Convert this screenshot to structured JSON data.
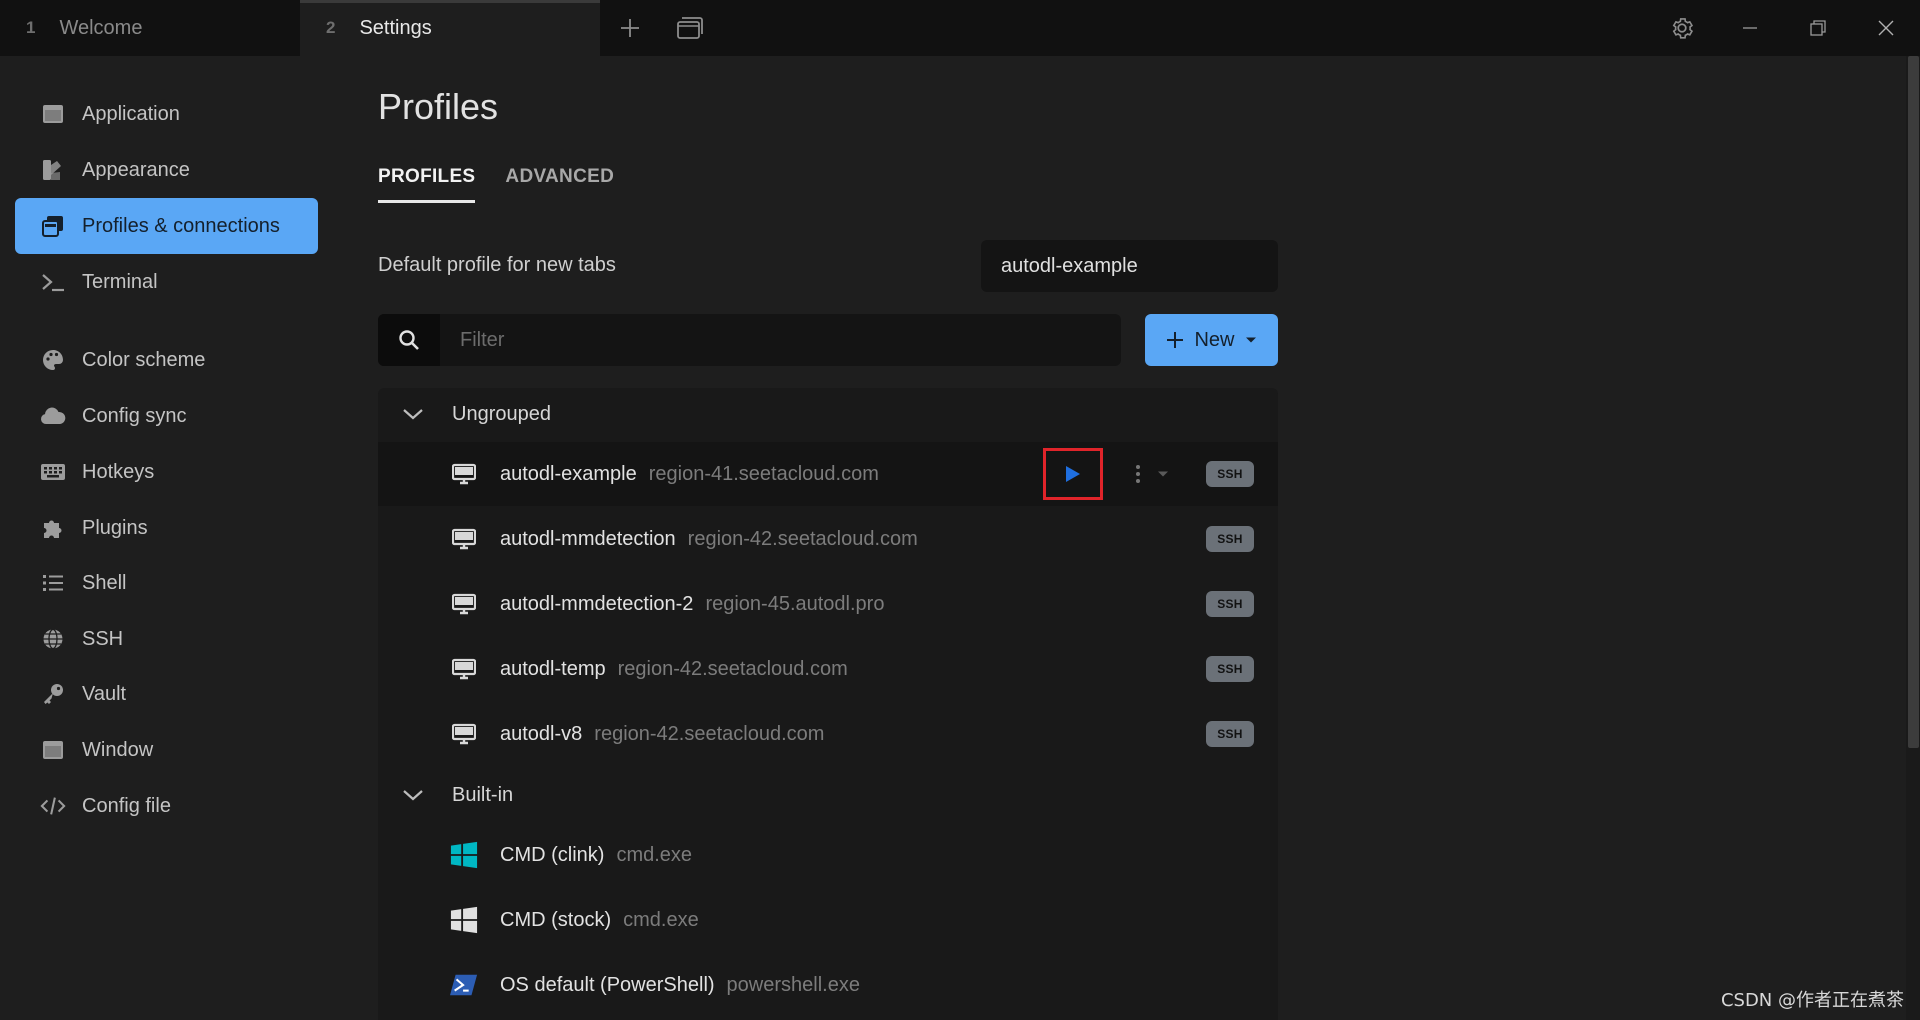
{
  "tabs": [
    {
      "number": "1",
      "label": "Welcome"
    },
    {
      "number": "2",
      "label": "Settings"
    }
  ],
  "titlebar_icons": [
    "plus-icon",
    "window-icon",
    "gear-icon",
    "minimize-icon",
    "restore-icon",
    "close-icon"
  ],
  "sidebar": {
    "items": [
      {
        "label": "Application",
        "icon": "application-icon"
      },
      {
        "label": "Appearance",
        "icon": "appearance-icon"
      },
      {
        "label": "Profiles & connections",
        "icon": "profiles-icon",
        "active": true
      },
      {
        "label": "Terminal",
        "icon": "terminal-icon"
      },
      {
        "label": "Color scheme",
        "icon": "palette-icon"
      },
      {
        "label": "Config sync",
        "icon": "cloud-icon"
      },
      {
        "label": "Hotkeys",
        "icon": "keyboard-icon"
      },
      {
        "label": "Plugins",
        "icon": "puzzle-icon"
      },
      {
        "label": "Shell",
        "icon": "list-icon"
      },
      {
        "label": "SSH",
        "icon": "globe-icon"
      },
      {
        "label": "Vault",
        "icon": "key-icon"
      },
      {
        "label": "Window",
        "icon": "window-icon"
      },
      {
        "label": "Config file",
        "icon": "code-icon"
      }
    ]
  },
  "main": {
    "title": "Profiles",
    "subtabs": [
      {
        "label": "PROFILES",
        "active": true
      },
      {
        "label": "ADVANCED"
      }
    ],
    "default_profile_label": "Default profile for new tabs",
    "default_profile_value": "autodl-example",
    "filter_placeholder": "Filter",
    "new_button_label": "New",
    "groups": [
      {
        "name": "Ungrouped",
        "profiles": [
          {
            "name": "autodl-example",
            "host": "region-41.seetacloud.com",
            "badge": "SSH",
            "icon": "monitor-icon"
          },
          {
            "name": "autodl-mmdetection",
            "host": "region-42.seetacloud.com",
            "badge": "SSH",
            "icon": "monitor-icon"
          },
          {
            "name": "autodl-mmdetection-2",
            "host": "region-45.autodl.pro",
            "badge": "SSH",
            "icon": "monitor-icon"
          },
          {
            "name": "autodl-temp",
            "host": "region-42.seetacloud.com",
            "badge": "SSH",
            "icon": "monitor-icon"
          },
          {
            "name": "autodl-v8",
            "host": "region-42.seetacloud.com",
            "badge": "SSH",
            "icon": "monitor-icon"
          }
        ]
      },
      {
        "name": "Built-in",
        "profiles": [
          {
            "name": "CMD (clink)",
            "host": "cmd.exe",
            "icon": "windows-logo-icon"
          },
          {
            "name": "CMD (stock)",
            "host": "cmd.exe",
            "icon": "windows-logo-icon"
          },
          {
            "name": "OS default (PowerShell)",
            "host": "powershell.exe",
            "icon": "powershell-icon"
          }
        ]
      }
    ]
  },
  "watermark": "CSDN @作者正在煮茶",
  "colors": {
    "accent": "#5aa7f5",
    "highlight_box": "#e0242a",
    "play_icon": "#1f6fe0",
    "windows_clink": "#00b7c3",
    "powershell": "#2c5db4"
  }
}
